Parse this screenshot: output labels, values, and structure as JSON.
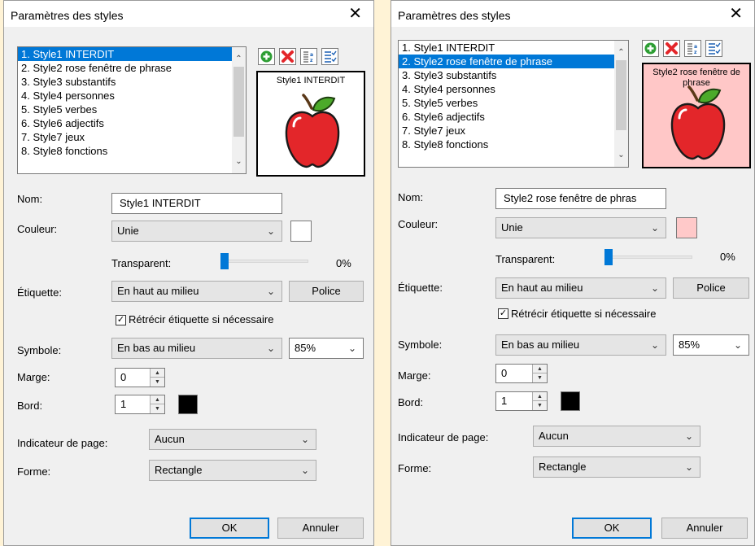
{
  "colors": {
    "accent": "#0078d7",
    "pink_swatch": "#ffc9c9",
    "preview_pink_bg": "#ffc7c7"
  },
  "left": {
    "title": "Paramètres des styles",
    "list": [
      "1.  Style1 INTERDIT",
      "2. Style2 rose fenêtre de phrase",
      "3.  Style3 substantifs",
      "4.  Style4 personnes",
      "5.  Style5 verbes",
      "6.  Style6 adjectifs",
      "7.  Style7 jeux",
      "8.  Style8 fonctions"
    ],
    "selected_index": 0,
    "preview_label": "Style1 INTERDIT",
    "nom_label": "Nom:",
    "nom_value": "Style1 INTERDIT",
    "couleur_label": "Couleur:",
    "couleur_value": "Unie",
    "couleur_swatch": "#ffffff",
    "transparent_label": "Transparent:",
    "transparent_value": "0%",
    "etiquette_label": "Étiquette:",
    "etiquette_value": "En haut au milieu",
    "police_label": "Police",
    "retrecir_label": "Rétrécir étiquette si nécessaire",
    "symbole_label": "Symbole:",
    "symbole_value": "En bas au milieu",
    "symbole_size": "85%",
    "marge_label": "Marge:",
    "marge_value": "0",
    "bord_label": "Bord:",
    "bord_value": "1",
    "indicateur_label": "Indicateur de page:",
    "indicateur_value": "Aucun",
    "forme_label": "Forme:",
    "forme_value": "Rectangle",
    "ok_label": "OK",
    "annuler_label": "Annuler"
  },
  "right": {
    "title": "Paramètres des styles",
    "list": [
      "1.  Style1 INTERDIT",
      "2.  Style2 rose fenêtre de phrase",
      "3.  Style3 substantifs",
      "4.  Style4 personnes",
      "5.  Style5 verbes",
      "6.  Style6 adjectifs",
      "7.  Style7 jeux",
      "8.  Style8 fonctions"
    ],
    "selected_index": 1,
    "preview_label": "Style2 rose fenêtre de phrase",
    "nom_label": "Nom:",
    "nom_value": "Style2 rose fenêtre de phras",
    "couleur_label": "Couleur:",
    "couleur_value": "Unie",
    "couleur_swatch": "#ffc9c9",
    "transparent_label": "Transparent:",
    "transparent_value": "0%",
    "etiquette_label": "Étiquette:",
    "etiquette_value": "En haut au milieu",
    "police_label": "Police",
    "retrecir_label": "Rétrécir étiquette si nécessaire",
    "symbole_label": "Symbole:",
    "symbole_value": "En bas au milieu",
    "symbole_size": "85%",
    "marge_label": "Marge:",
    "marge_value": "0",
    "bord_label": "Bord:",
    "bord_value": "1",
    "indicateur_label": "Indicateur de page:",
    "indicateur_value": "Aucun",
    "forme_label": "Forme:",
    "forme_value": "Rectangle",
    "ok_label": "OK",
    "annuler_label": "Annuler"
  }
}
